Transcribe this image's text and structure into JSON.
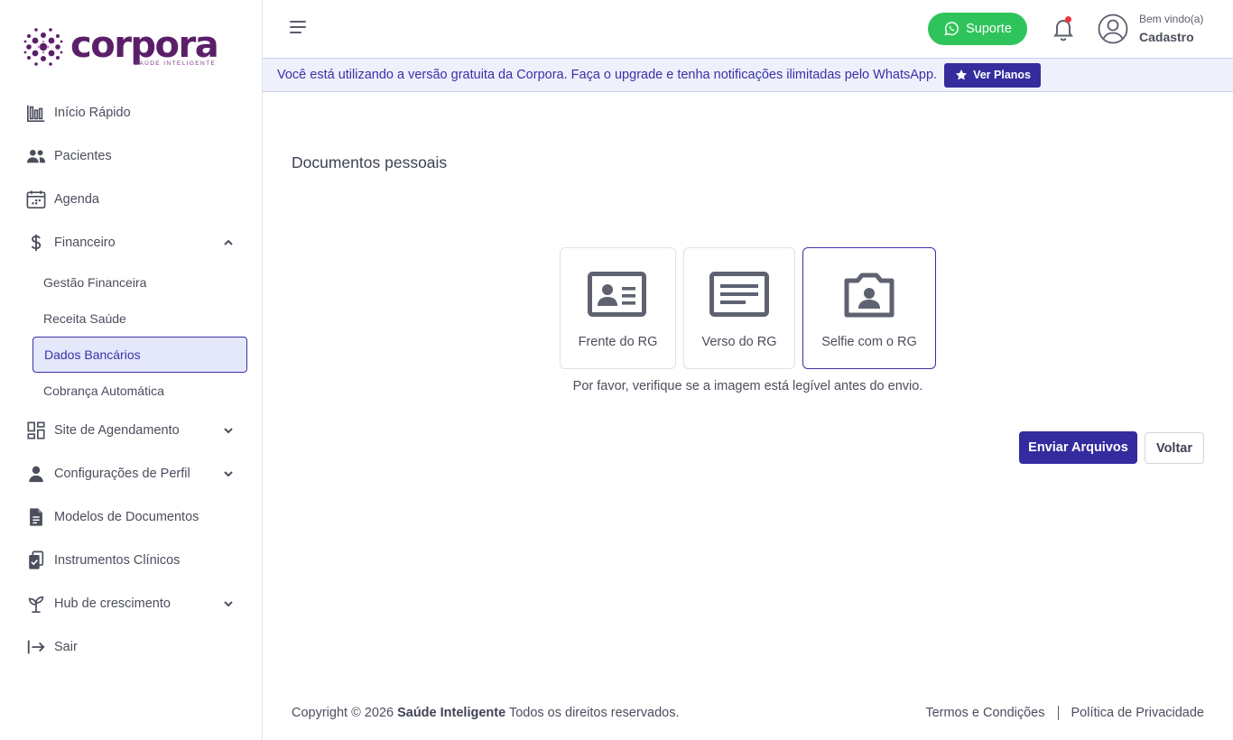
{
  "brand": {
    "name": "corpora",
    "tagline": "SAÚDE INTELIGENTE",
    "color": "#5b1f6a"
  },
  "sidebar": {
    "items": [
      {
        "label": "Início Rápido",
        "icon": "bar-chart-icon"
      },
      {
        "label": "Pacientes",
        "icon": "users-icon"
      },
      {
        "label": "Agenda",
        "icon": "calendar-icon"
      },
      {
        "label": "Financeiro",
        "icon": "dollar-icon",
        "expanded": true,
        "children": [
          {
            "label": "Gestão Financeira"
          },
          {
            "label": "Receita Saúde"
          },
          {
            "label": "Dados Bancários",
            "active": true
          },
          {
            "label": "Cobrança Automática"
          }
        ]
      },
      {
        "label": "Site de Agendamento",
        "icon": "grid-icon"
      },
      {
        "label": "Configurações de Perfil",
        "icon": "person-icon"
      },
      {
        "label": "Modelos de Documentos",
        "icon": "document-icon"
      },
      {
        "label": "Instrumentos Clínicos",
        "icon": "clipboard-icon"
      },
      {
        "label": "Hub de crescimento",
        "icon": "sprout-icon"
      },
      {
        "label": "Sair",
        "icon": "logout-icon"
      }
    ]
  },
  "header": {
    "support_label": "Suporte",
    "welcome": "Bem vindo(a)",
    "user_name": "Cadastro",
    "notification_dot": true
  },
  "banner": {
    "text": "Você está utilizando a versão gratuita da Corpora. Faça o upgrade e tenha notificações ilimitadas pelo WhatsApp.",
    "button_label": "Ver Planos"
  },
  "main": {
    "title": "Documentos pessoais",
    "cards": [
      {
        "label": "Frente do RG",
        "icon": "id-card-icon"
      },
      {
        "label": "Verso do RG",
        "icon": "id-back-icon"
      },
      {
        "label": "Selfie com o RG",
        "icon": "camera-person-icon",
        "selected": true
      }
    ],
    "hint": "Por favor, verifique se a imagem está legível antes do envio.",
    "send_label": "Enviar Arquivos",
    "back_label": "Voltar"
  },
  "footer": {
    "copyright_prefix": "Copyright © 2026",
    "company": "Saúde Inteligente",
    "rights": "Todos os direitos reservados.",
    "terms": "Termos e Condições",
    "privacy": "Política de Privacidade"
  },
  "colors": {
    "primary": "#342b9e",
    "support_green": "#2fc45b",
    "banner_bg": "#eef0fc",
    "active_bg": "#e5e7fb"
  }
}
